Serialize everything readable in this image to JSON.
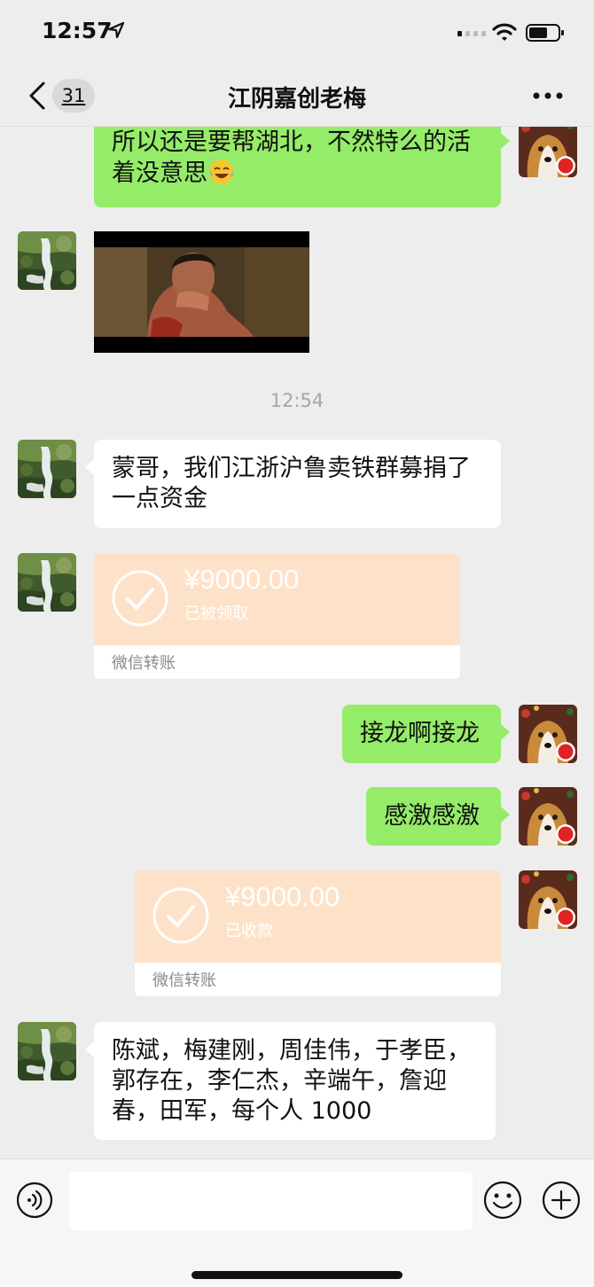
{
  "status_bar": {
    "time": "12:57"
  },
  "nav": {
    "back_count": "31",
    "title": "江阴嘉创老梅"
  },
  "messages": [
    {
      "text": "所以还是要帮湖北，不然特么的活着没意思"
    },
    {
      "timestamp": "12:54"
    },
    {
      "text": "蒙哥，我们江浙沪鲁卖铁群募捐了一点资金"
    },
    {
      "amount": "¥9000.00",
      "status": "已被领取",
      "label": "微信转账"
    },
    {
      "text": "接龙啊接龙"
    },
    {
      "text": "感激感激"
    },
    {
      "amount": "¥9000.00",
      "status": "已收款",
      "label": "微信转账"
    },
    {
      "text": "陈斌，梅建刚，周佳伟，于孝臣，郭存在，李仁杰，辛端午，詹迎春，田军，每个人 1000"
    }
  ],
  "colors": {
    "outgoing_bubble": "#95ec69",
    "incoming_bubble": "#ffffff",
    "transfer_card": "#fde2c9",
    "background": "#ededed"
  }
}
